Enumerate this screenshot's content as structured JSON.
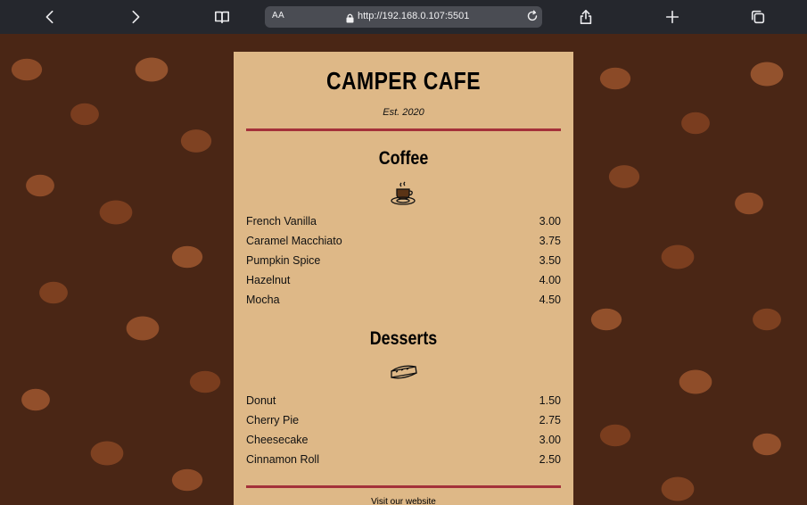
{
  "browser": {
    "address_prefix": "AA",
    "url": "http://192.168.0.107:5501"
  },
  "menu": {
    "cafe_name": "CAMPER CAFE",
    "established": "Est. 2020",
    "coffee": {
      "title": "Coffee",
      "items": [
        {
          "name": "French Vanilla",
          "price": "3.00"
        },
        {
          "name": "Caramel Macchiato",
          "price": "3.75"
        },
        {
          "name": "Pumpkin Spice",
          "price": "3.50"
        },
        {
          "name": "Hazelnut",
          "price": "4.00"
        },
        {
          "name": "Mocha",
          "price": "4.50"
        }
      ]
    },
    "desserts": {
      "title": "Desserts",
      "items": [
        {
          "name": "Donut",
          "price": "1.50"
        },
        {
          "name": "Cherry Pie",
          "price": "2.75"
        },
        {
          "name": "Cheesecake",
          "price": "3.00"
        },
        {
          "name": "Cinnamon Roll",
          "price": "2.50"
        }
      ]
    },
    "footer_link": "Visit our website"
  },
  "colors": {
    "card_background": "#deb887",
    "divider": "#a4313a",
    "toolbar": "#25272d"
  },
  "icons": [
    "back-icon",
    "forward-icon",
    "reader-icon",
    "lock-icon",
    "reload-icon",
    "share-icon",
    "new-tab-icon",
    "tabs-icon",
    "coffee-cup-icon",
    "pie-slice-icon"
  ]
}
